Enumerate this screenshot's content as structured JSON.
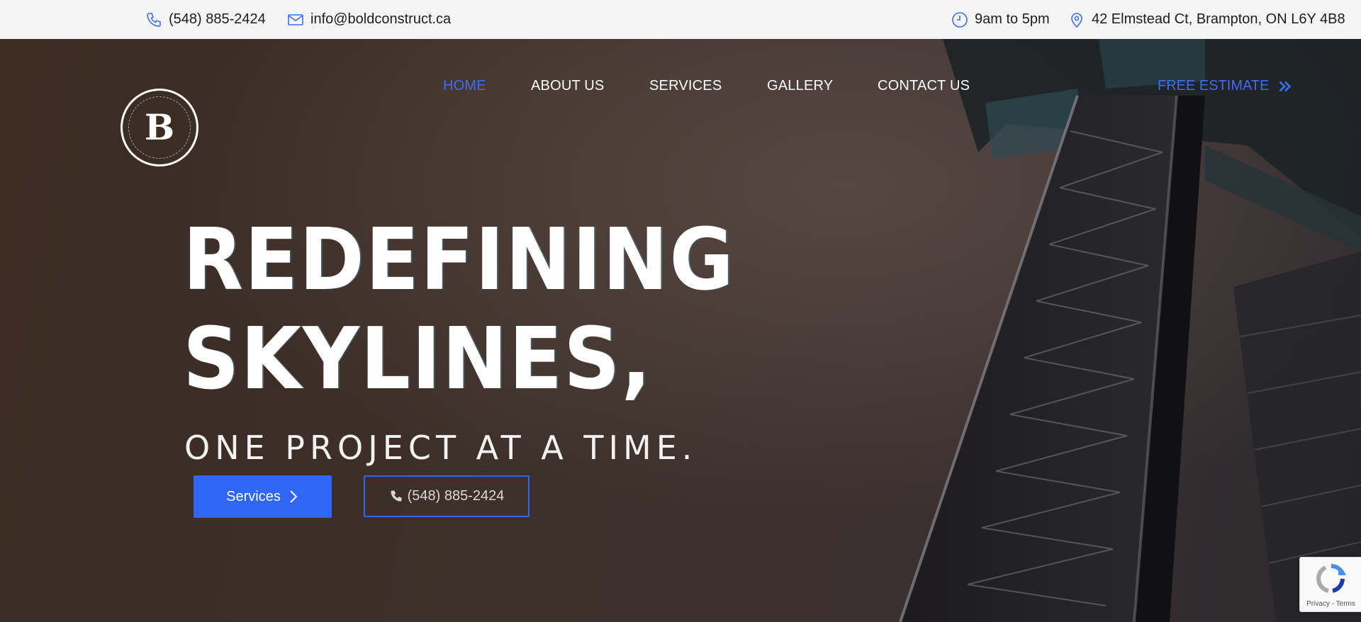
{
  "topbar": {
    "phone": "(548) 885-2424",
    "email": "info@boldconstruct.ca",
    "hours": "9am to 5pm",
    "address": "42 Elmstead Ct, Brampton, ON L6Y 4B8",
    "icons": [
      "phone-icon",
      "mail-icon",
      "clock-icon",
      "location-pin-icon"
    ]
  },
  "logo": {
    "letter": "B"
  },
  "nav": {
    "items": [
      "HOME",
      "ABOUT US",
      "SERVICES",
      "GALLERY",
      "CONTACT US"
    ],
    "active": "HOME",
    "cta": "FREE ESTIMATE"
  },
  "hero": {
    "line1": "REDEFINING",
    "line2": "SKYLINES,",
    "subline": "ONE PROJECT AT A TIME.",
    "services_button": "Services",
    "phone_button": "(548) 885-2424"
  },
  "recaptcha": {
    "terms": "Privacy - Terms"
  },
  "colors": {
    "accent": "#2f66f5",
    "nav_active": "#3d6ef0",
    "topbar_bg": "#f5f5f5"
  }
}
